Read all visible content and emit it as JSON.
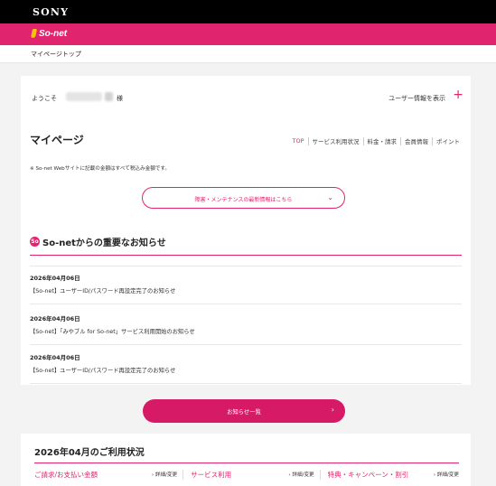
{
  "brand": {
    "sony": "SONY",
    "sonet": "So-net"
  },
  "breadcrumb": "マイページトップ",
  "welcome": {
    "greeting": "ようこそ",
    "honorific": "様",
    "user_info_link": "ユーザー情報を表示",
    "plus": "+"
  },
  "mypage": {
    "title": "マイページ",
    "tabs": [
      {
        "label": "TOP",
        "active": true
      },
      {
        "label": "サービス利用状況"
      },
      {
        "label": "料金・請求"
      },
      {
        "label": "会員情報"
      },
      {
        "label": "ポイント"
      }
    ],
    "note": "※ So-net Webサイトに記載の金額はすべて税込み金額です。",
    "outage_button": "障害・メンテナンスの最新情報はこちら",
    "outage_chevron": "⌄"
  },
  "news": {
    "icon": "So",
    "title": "So-netからの重要なお知らせ",
    "items": [
      {
        "date": "2026年04月06日",
        "text": "【So-net】ユーザーID/パスワード再設定完了のお知らせ"
      },
      {
        "date": "2026年04月06日",
        "text": "【So-net】「みやブル for So-net」サービス利用開始のお知らせ"
      },
      {
        "date": "2026年04月06日",
        "text": "【So-net】ユーザーID/パスワード再設定完了のお知らせ"
      }
    ],
    "all_button": "お知らせ一覧",
    "all_chevron": "›"
  },
  "usage": {
    "title": "2026年04月のご利用状況",
    "cells": [
      {
        "category": "ご請求/お支払い金額",
        "link": "› 詳細/変更"
      },
      {
        "category": "サービス利用",
        "link": "› 詳細/変更"
      },
      {
        "category": "特典・キャンペーン・割引",
        "link": "› 詳細/変更"
      }
    ]
  },
  "colors": {
    "brand_pink": "#e0246d",
    "black": "#000000",
    "background": "#f3f3f3"
  },
  "icons": [
    "sonet-logo-icon",
    "plus-icon",
    "chevron-down-icon",
    "news-alert-icon",
    "chevron-right-icon"
  ]
}
